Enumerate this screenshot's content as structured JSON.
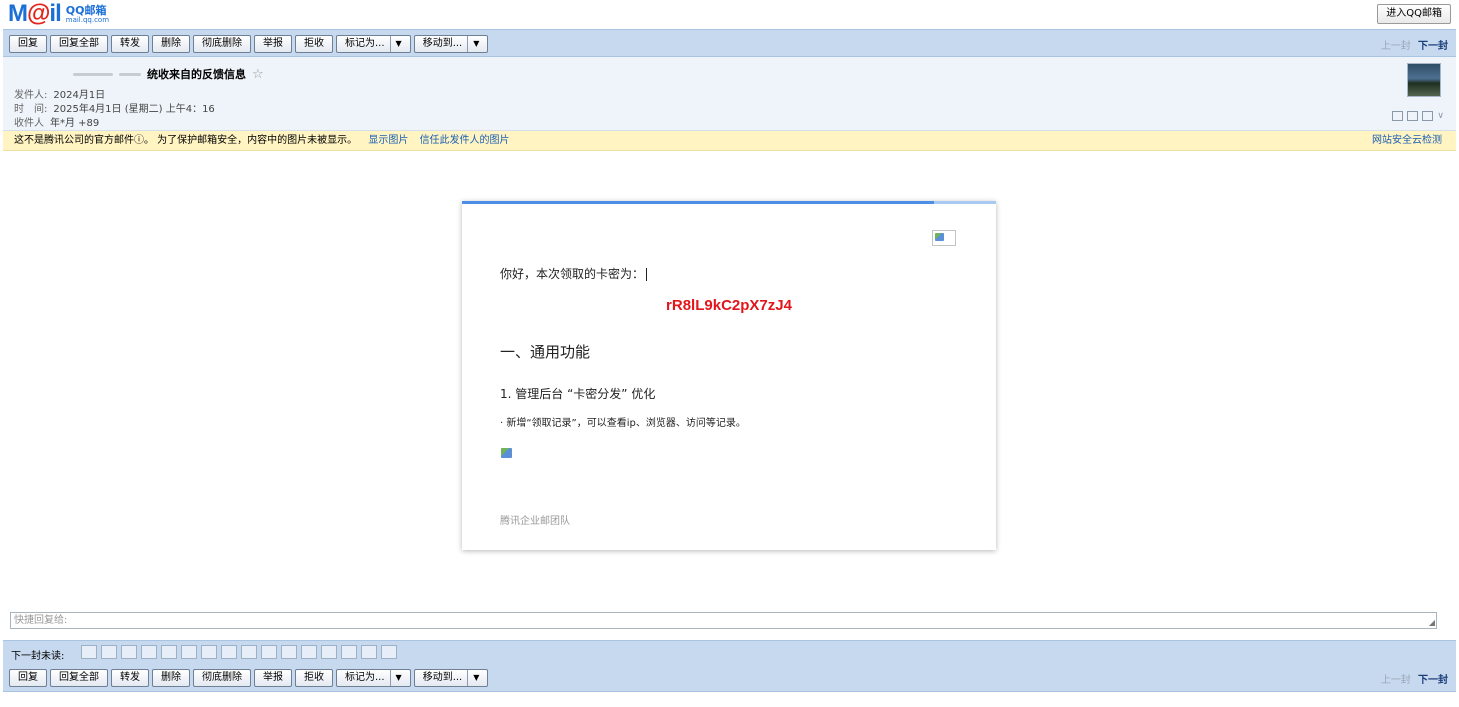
{
  "header": {
    "logo_main": "Mail",
    "logo_cn": "QQ邮箱",
    "logo_url": "mail.qq.com",
    "enter_button": "进入QQ邮箱"
  },
  "toolbar": {
    "reply": "回复",
    "reply_all": "回复全部",
    "forward": "转发",
    "delete": "删除",
    "delete_forever": "彻底删除",
    "report": "举报",
    "reject": "拒收",
    "mark_as": "标记为...",
    "move_to": "移动到...",
    "prev": "上一封",
    "next": "下一封"
  },
  "mail": {
    "subject": "统收来自的反馈信息",
    "sender_label": "发件人:",
    "sender_value": "2024月1日",
    "time_label": "时　间:",
    "time_value": "2025年4月1日 (星期二) 上午4：16",
    "recipient_label": "收件人",
    "recipient_value": "年*月 +89"
  },
  "warning": {
    "message": "这不是腾讯公司的官方邮件ⓘ。 为了保护邮箱安全，内容中的图片未被显示。",
    "show_images": "显示图片",
    "trust_sender": "信任此发件人的图片",
    "security_check": "网站安全云检测"
  },
  "content": {
    "greeting": "你好，本次领取的卡密为：",
    "code": "rR8lL9kC2pX7zJ4",
    "heading": "一、通用功能",
    "subheading": "1. 管理后台 “卡密分发” 优化",
    "paragraph": "· 新增“领取记录”，可以查看ip、浏览器、访问等记录。",
    "signature": "腾讯企业邮团队"
  },
  "quick_reply": {
    "placeholder": "快捷回复给:"
  },
  "next_unread": {
    "label": "下一封未读:"
  }
}
